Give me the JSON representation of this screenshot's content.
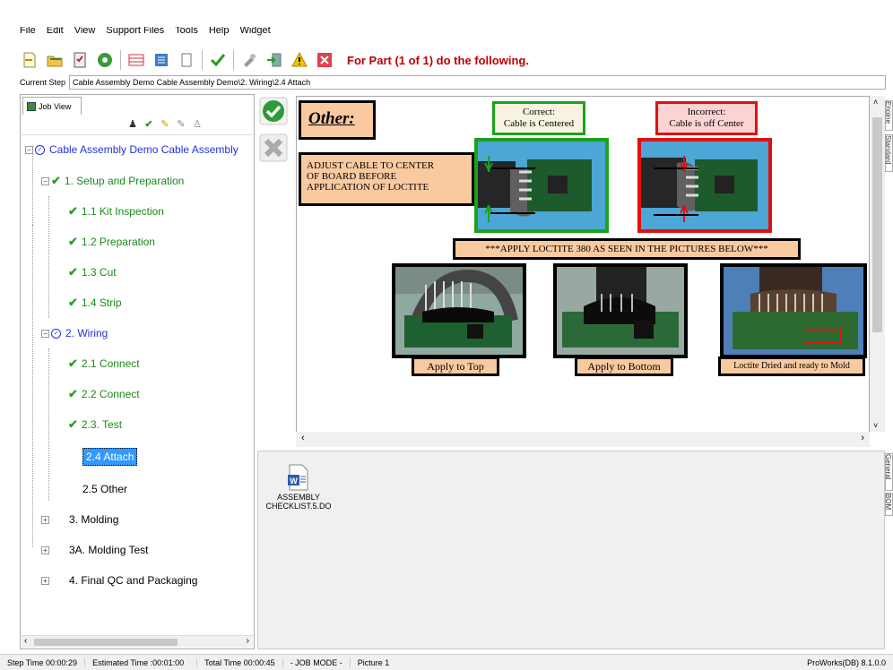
{
  "menu": [
    "File",
    "Edit",
    "View",
    "Support Files",
    "Tools",
    "Help",
    "Widget"
  ],
  "toolbar": {
    "part_text": "For Part (1 of 1) do the following."
  },
  "step_bar": {
    "label": "Current Step",
    "path": "Cable Assembly Demo Cable Assembly Demo\\2. Wiring\\2.4 Attach"
  },
  "left_panel": {
    "tab": "Job View",
    "tree": {
      "root": "Cable Assembly Demo Cable Assembly",
      "n1": "1. Setup and Preparation",
      "n11": "1.1 Kit Inspection",
      "n12": "1.2 Preparation",
      "n13": "1.3 Cut",
      "n14": "1.4 Strip",
      "n2": "2. Wiring",
      "n21": "2.1 Connect",
      "n22": "2.2 Connect",
      "n23": "2.3. Test",
      "n24": "2.4 Attach",
      "n25": "2.5 Other",
      "n3": "3. Molding",
      "n3a": "3A. Molding Test",
      "n4": "4. Final QC and Packaging"
    }
  },
  "doc": {
    "other": "Other:",
    "adjust": "ADJUST CABLE TO CENTER OF BOARD BEFORE APPLICATION OF LOCTITE",
    "correct": "Correct:\nCable is Centered",
    "incorrect": "Incorrect:\nCable is off Center",
    "apply_banner": "***APPLY LOCTITE 380 AS SEEN IN THE PICTURES BELOW***",
    "top": "Apply to Top",
    "bottom": "Apply to Bottom",
    "dried": "Loctite Dried and ready to Mold"
  },
  "attachment": {
    "line1": "ASSEMBLY",
    "line2": "CHECKLIST.5.DO"
  },
  "side_tabs": {
    "t1": "Engine",
    "t2": "Standard",
    "t3": "General",
    "t4": "BOM"
  },
  "status": {
    "step_time": "Step Time 00:00:29",
    "est_time": "Estimated Time :00:01:00",
    "total_time": "Total Time 00:00:45",
    "mode": "- JOB MODE -",
    "picture": "Picture 1",
    "version": "ProWorks(DB) 8.1.0.0"
  },
  "colors": {
    "accent_red": "#c00000",
    "green_text": "#1a8a1a",
    "blue_text": "#2233dd",
    "selection": "#3399ff",
    "callout_fill": "#f9c9a0"
  }
}
